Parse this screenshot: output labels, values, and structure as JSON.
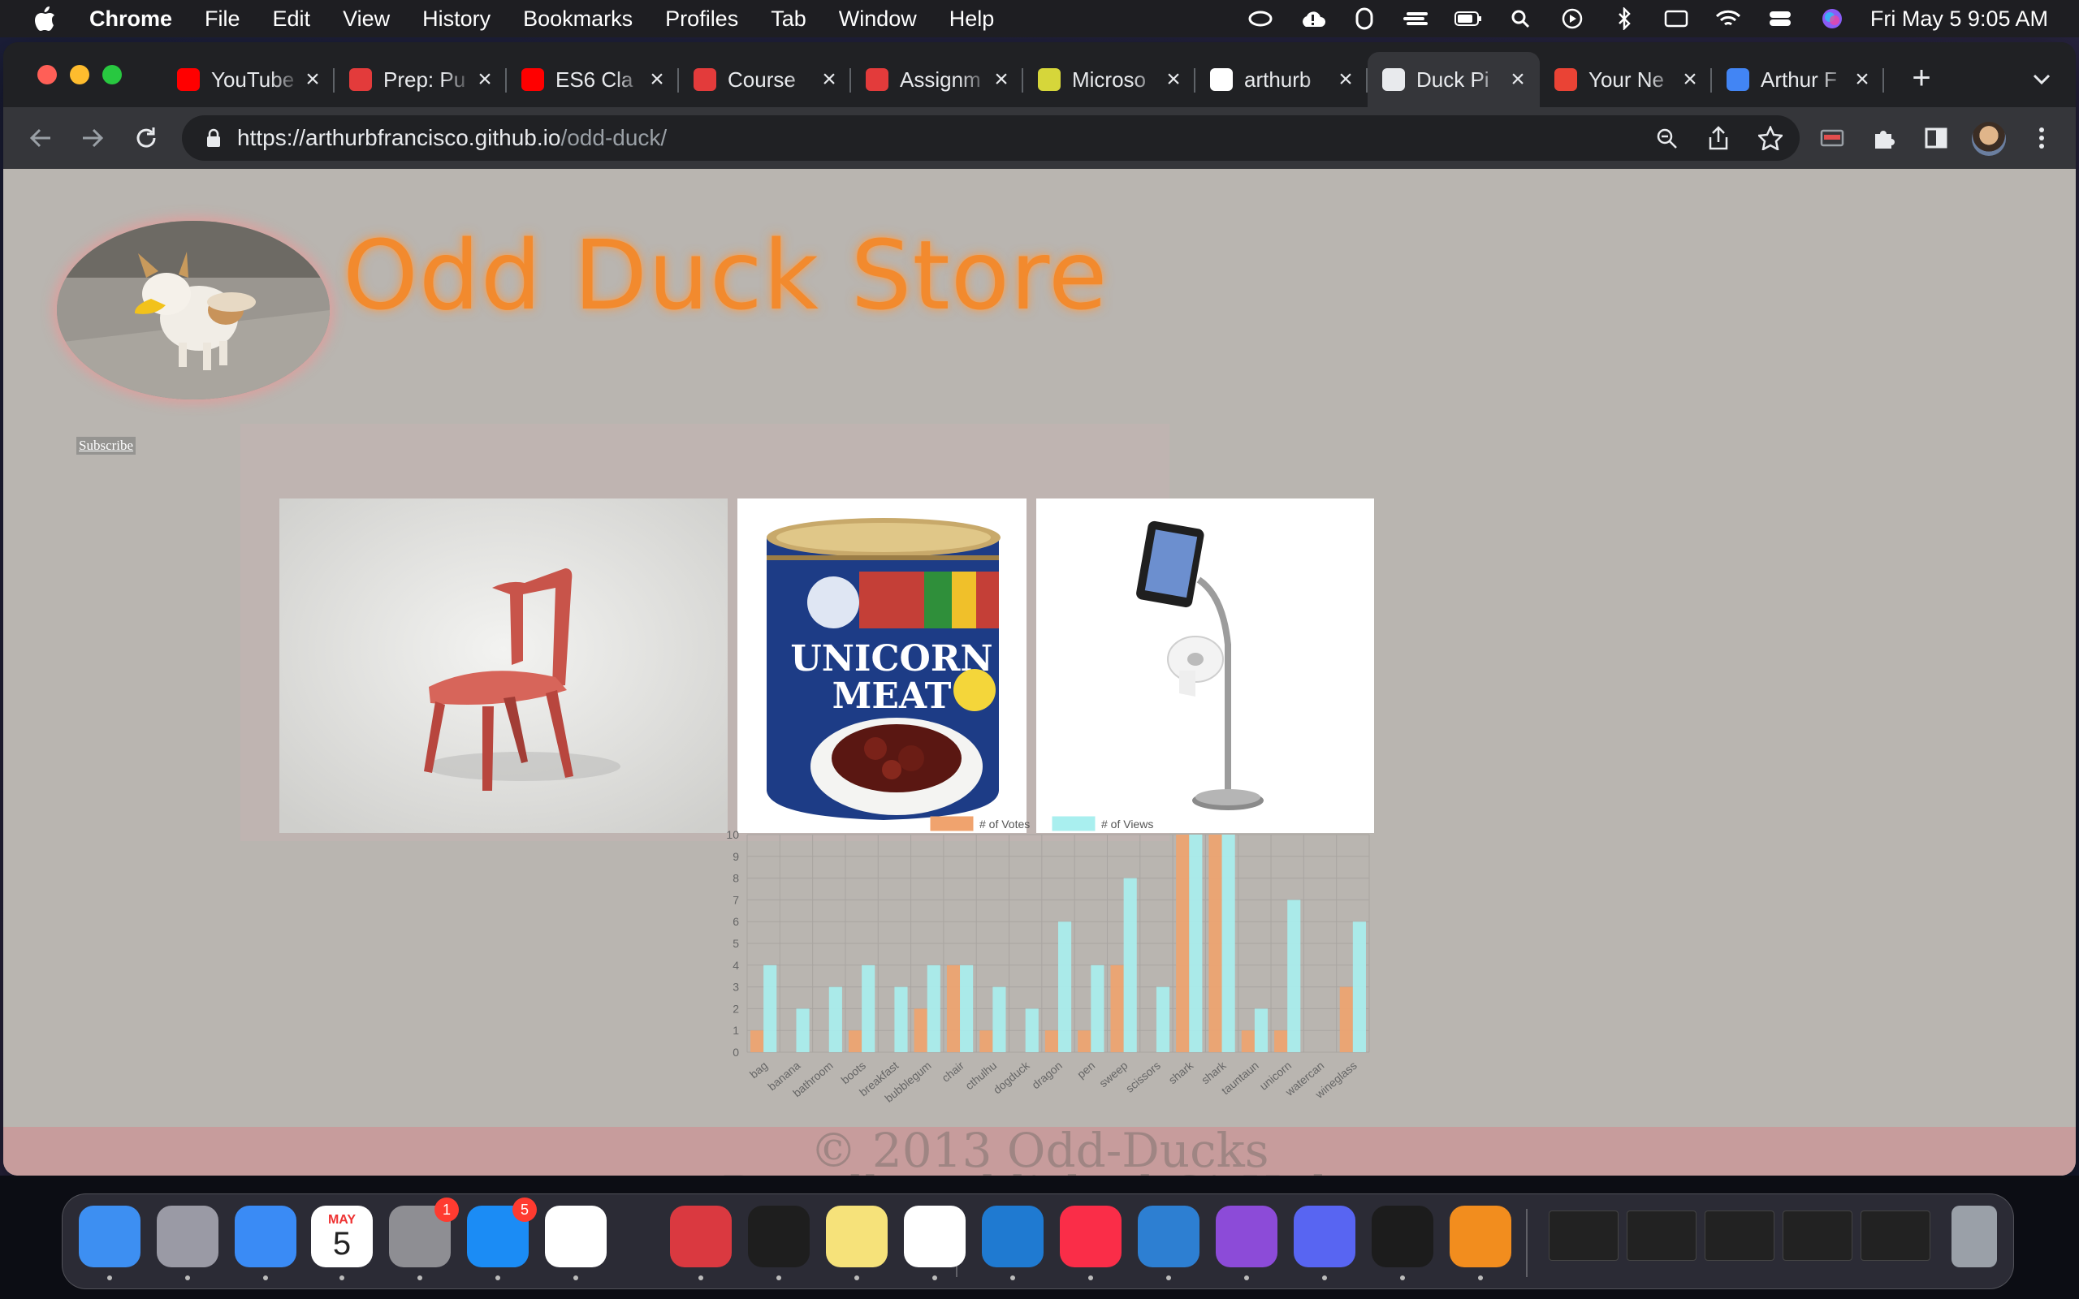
{
  "menubar": {
    "app_name": "Chrome",
    "items": [
      "File",
      "Edit",
      "View",
      "History",
      "Bookmarks",
      "Profiles",
      "Tab",
      "Window",
      "Help"
    ],
    "clock": "Fri May 5  9:05 AM"
  },
  "browser": {
    "tabs": [
      {
        "title": "YouTube",
        "favicon": "youtube-icon",
        "color": "#ff0000"
      },
      {
        "title": "Prep: Pu",
        "favicon": "codefellows-icon",
        "color": "#e33b3b"
      },
      {
        "title": "ES6 Cla",
        "favicon": "youtube-icon",
        "color": "#ff0000"
      },
      {
        "title": "Course",
        "favicon": "code-shield-icon",
        "color": "#e33b3b"
      },
      {
        "title": "Assignm",
        "favicon": "codefellows-icon",
        "color": "#e33b3b"
      },
      {
        "title": "Microso",
        "favicon": "microsoft-shield-icon",
        "color": "#d6d63a"
      },
      {
        "title": "arthurb",
        "favicon": "github-icon",
        "color": "#ffffff"
      },
      {
        "title": "Duck Pi",
        "favicon": "globe-icon",
        "color": "#e8eaed",
        "active": true
      },
      {
        "title": "Your Ne",
        "favicon": "gmail-icon",
        "color": "#ea4335"
      },
      {
        "title": "Arthur F",
        "favicon": "docs-icon",
        "color": "#4285f4"
      }
    ],
    "url_host": "https://arthurbfrancisco.github.io",
    "url_path": "/odd-duck/"
  },
  "page": {
    "title": "Odd Duck Store",
    "subscribe": "Subscribe",
    "footer_line1": "© 2013 Odd-Ducks",
    "footer_line2": "Proudly published GitHub."
  },
  "chart_data": {
    "type": "bar",
    "categories": [
      "bag",
      "banana",
      "bathroom",
      "boots",
      "breakfast",
      "bubblegum",
      "chair",
      "cthulhu",
      "dogduck",
      "dragon",
      "pen",
      "sweep",
      "scissors",
      "shark",
      "shark",
      "tauntaun",
      "unicorn",
      "watercan",
      "wineglass"
    ],
    "series": [
      {
        "name": "# of Votes",
        "color": "#f0a36e",
        "values": [
          1,
          0,
          0,
          1,
          0,
          2,
          4,
          1,
          0,
          1,
          1,
          4,
          0,
          10,
          10,
          1,
          1,
          0,
          3
        ]
      },
      {
        "name": "# of Views",
        "color": "#a9efef",
        "values": [
          4,
          2,
          3,
          4,
          3,
          4,
          4,
          3,
          2,
          6,
          4,
          8,
          3,
          10,
          10,
          2,
          7,
          0,
          6
        ]
      }
    ],
    "ylim": [
      0,
      10
    ],
    "yticks": [
      "0",
      "1",
      "2",
      "3",
      "4",
      "5",
      "6",
      "7",
      "8",
      "9",
      "10"
    ],
    "grid": true,
    "legend": "top"
  },
  "dock": {
    "apps": [
      {
        "name": "finder-icon",
        "color": "#3d8ff2"
      },
      {
        "name": "launchpad-icon",
        "color": "#9a9aa5"
      },
      {
        "name": "mail-icon",
        "color": "#3a8bf5"
      },
      {
        "name": "calendar-icon",
        "color": "#ffffff",
        "month": "MAY",
        "day": "5"
      },
      {
        "name": "system-settings-icon",
        "color": "#8e8e93",
        "badge": "1"
      },
      {
        "name": "app-store-icon",
        "color": "#1b8cf5",
        "badge": "5"
      },
      {
        "name": "chrome-icon",
        "color": "#ffffff"
      },
      {
        "name": "expressvpn-icon",
        "color": "#da3940"
      },
      {
        "name": "terminal-icon",
        "color": "#1e1e1e"
      },
      {
        "name": "notes-icon",
        "color": "#f6e27a"
      },
      {
        "name": "slack-icon",
        "color": "#ffffff"
      },
      {
        "name": "vscode-icon",
        "color": "#1f7ad1"
      },
      {
        "name": "music-icon",
        "color": "#fa2d48"
      },
      {
        "name": "affinity-designer-icon",
        "color": "#2d7fd2"
      },
      {
        "name": "affinity-photo-icon",
        "color": "#8c4bd8"
      },
      {
        "name": "discord-icon",
        "color": "#5865f2"
      },
      {
        "name": "activity-monitor-icon",
        "color": "#1c1c1c"
      },
      {
        "name": "books-icon",
        "color": "#f28d1e"
      }
    ]
  }
}
